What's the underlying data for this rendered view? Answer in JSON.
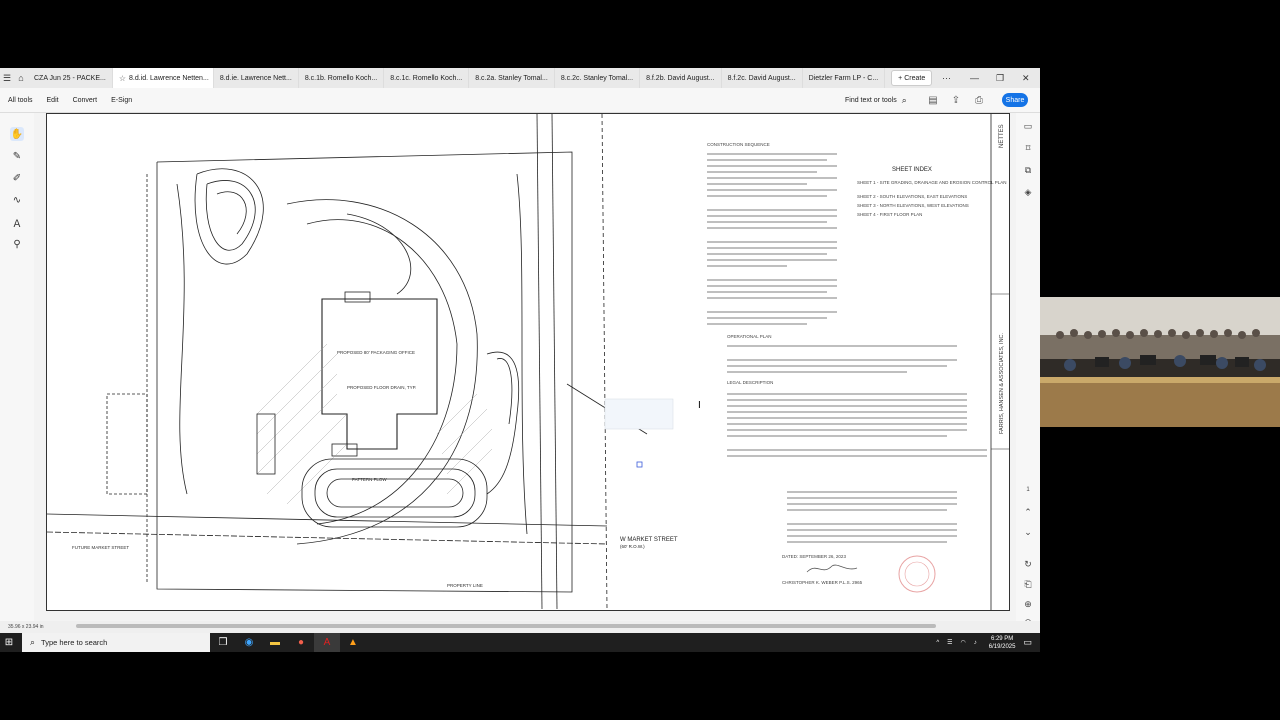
{
  "tabs": [
    {
      "label": "CZA Jun 25 - PACKE..."
    },
    {
      "label": "8.d.id. Lawrence Netten...",
      "active": true
    },
    {
      "label": "8.d.ie. Lawrence Nett..."
    },
    {
      "label": "8.c.1b. Romello Koch..."
    },
    {
      "label": "8.c.1c. Romello Koch..."
    },
    {
      "label": "8.c.2a. Stanley Tomal..."
    },
    {
      "label": "8.c.2c. Stanley Tomal..."
    },
    {
      "label": "8.f.2b. David August..."
    },
    {
      "label": "8.f.2c. David August..."
    },
    {
      "label": "Dietzler Farm LP - C..."
    }
  ],
  "create_label": "Create",
  "toolbar": {
    "all_tools": "All tools",
    "edit": "Edit",
    "convert": "Convert",
    "esign": "E-Sign",
    "find": "Find text or tools",
    "share": "Share"
  },
  "drawing": {
    "sheet_index_title": "SHEET INDEX",
    "sheet_index": [
      "SHEET 1 - SITE GRADING, DRAINAGE AND EROSION CONTROL PLAN",
      "SHEET 2 - SOUTH ELEVATIONS, EAST ELEVATIONS",
      "SHEET 3 - NORTH ELEVATIONS, WEST ELEVATIONS",
      "SHEET 4 - FIRST FLOOR PLAN"
    ],
    "street_label": "W MARKET STREET",
    "street_sub": "(60' R.O.W.)",
    "construction_sequence": "CONSTRUCTION SEQUENCE",
    "operational_plan": "OPERATIONAL PLAN",
    "legal_description": "LEGAL DESCRIPTION",
    "firm_name": "FARRIS, HANSEN & ASSOCIATES, INC.",
    "title_block_short": "NETTES",
    "dated": "DATED: SEPTEMBER 26, 2023",
    "surveyor": "CHRISTOPHER K. WEBER P.L.S. 2965",
    "building_label": "PROPOSED 80' PACKAGING OFFICE",
    "floor_drain_label": "PROPOSED FLOOR DRAIN, TYP.",
    "pattern_flow": "PATTERN FLOW",
    "property_line": "PROPERTY LINE",
    "future_market": "FUTURE MARKET STREET"
  },
  "status_text": "35.96 x 23.94 in",
  "taskbar": {
    "search_placeholder": "Type here to search",
    "time": "6:29 PM",
    "date": "6/19/2025"
  }
}
